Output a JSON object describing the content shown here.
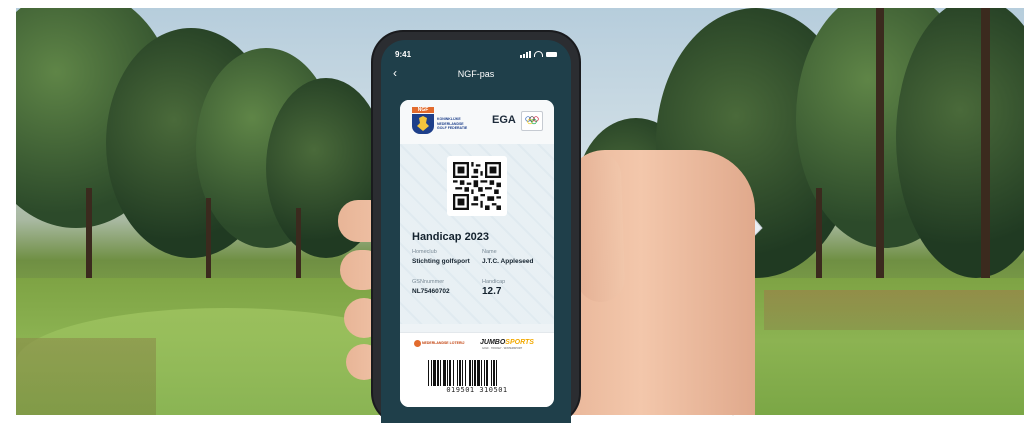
{
  "status_bar": {
    "time": "9:41"
  },
  "nav": {
    "back_icon": "chevron-left-icon",
    "title": "NGF-pas"
  },
  "card": {
    "issuer": {
      "tag": "NGF",
      "name_line1": "KONINKLIJKE",
      "name_line2": "NEDERLANDSE",
      "name_line3": "GOLF FEDERATIE"
    },
    "partner": {
      "name": "EGA"
    },
    "title": "Handicap 2023",
    "fields": {
      "homeclub_label": "Homeclub",
      "homeclub_value": "Stichting golfsport",
      "name_label": "Name",
      "name_value": "J.T.C. Appleseed",
      "gsn_label": "GSNnummer",
      "gsn_value": "NL75460702",
      "handicap_label": "Handicap",
      "handicap_value": "12.7"
    },
    "sponsors": {
      "sponsor1": "NEDERLANDSE LOTERIJ",
      "sponsor2_prefix": "JUMBO",
      "sponsor2_suffix": "SPORTS",
      "sponsor2_sub": "GOLF · HOCKEY · WINTERSPORT"
    },
    "barcode_number": "019501 310501"
  },
  "colors": {
    "phone_screen": "#1f3f4a",
    "ngf_blue": "#1d3f8a",
    "ngf_orange": "#e26b2d"
  }
}
